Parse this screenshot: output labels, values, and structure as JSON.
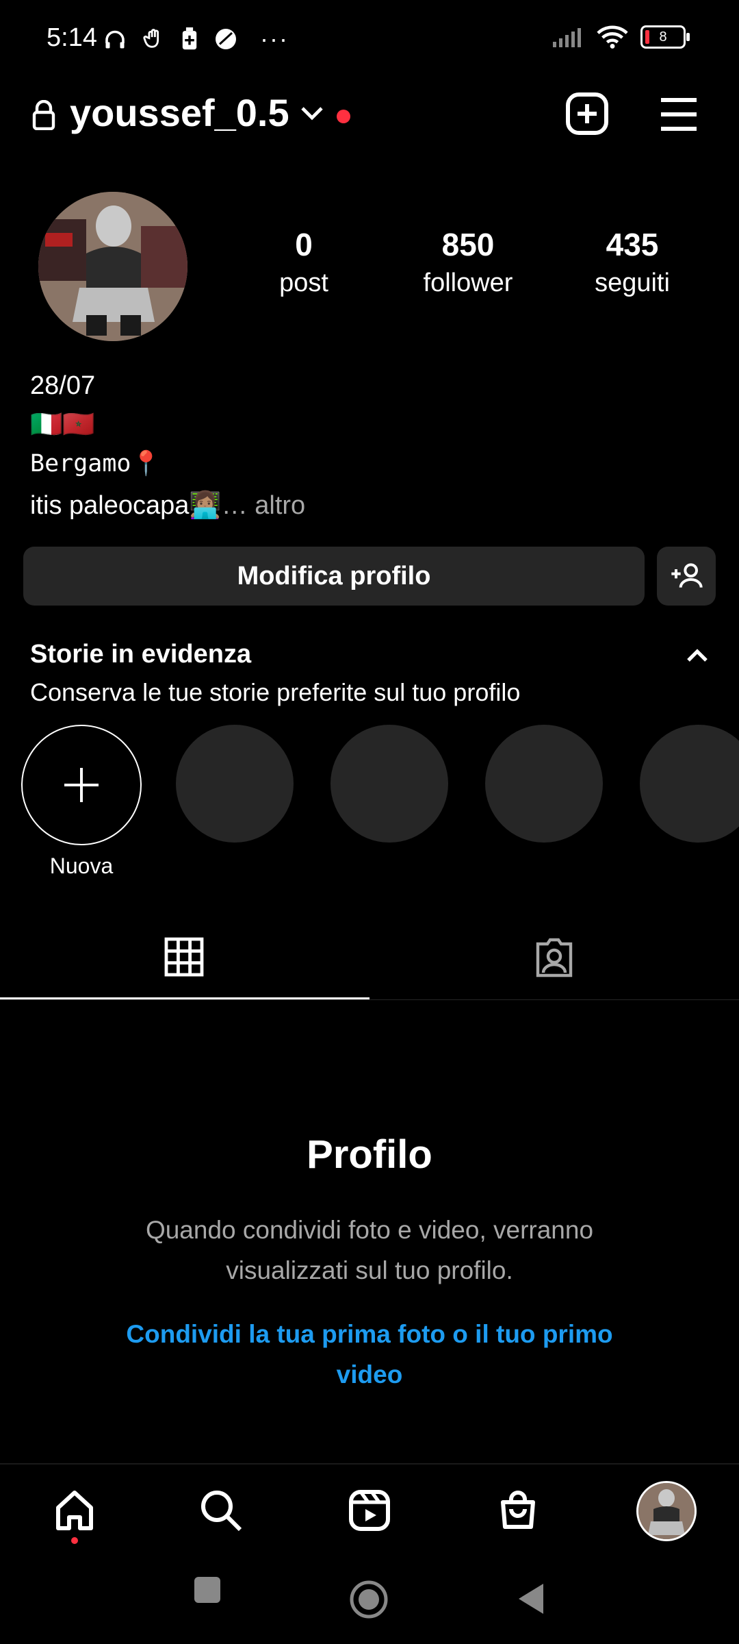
{
  "status_bar": {
    "time": "5:14",
    "overflow": "···",
    "battery_level": "8"
  },
  "header": {
    "username": "youssef_0.5"
  },
  "profile": {
    "stats": [
      {
        "value": "0",
        "label": "post"
      },
      {
        "value": "850",
        "label": "follower"
      },
      {
        "value": "435",
        "label": "seguiti"
      }
    ],
    "bio": {
      "line1": "28/07",
      "line2": "🇮🇹🇲🇦",
      "line3": "Bergamo📍",
      "line4": "itis paleocapa👩🏽‍💻",
      "more": "… altro"
    }
  },
  "actions": {
    "edit_profile": "Modifica profilo"
  },
  "highlights": {
    "title": "Storie in evidenza",
    "subtitle": "Conserva le tue storie preferite sul tuo profilo",
    "new_label": "Nuova"
  },
  "empty_state": {
    "title": "Profilo",
    "description": "Quando condividi foto e video, verranno visualizzati sul tuo profilo.",
    "link": "Condividi la tua prima foto o il tuo primo video"
  },
  "colors": {
    "background": "#000000",
    "button": "#262626",
    "accent_red": "#ff3040",
    "link_blue": "#1d9bf0"
  }
}
